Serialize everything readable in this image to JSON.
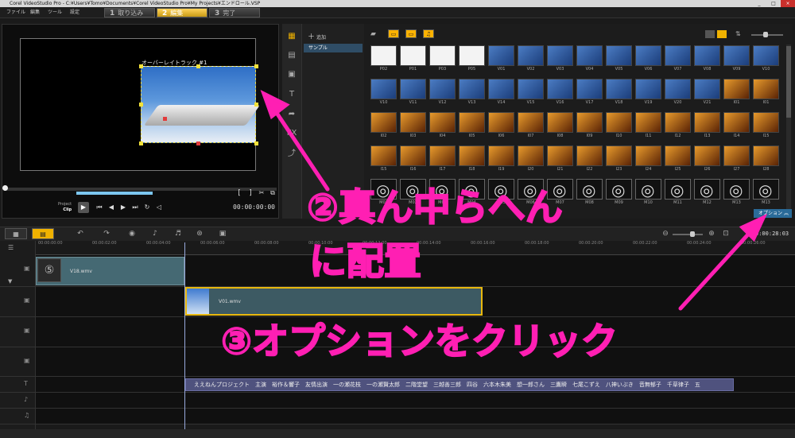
{
  "window": {
    "title": "Corel VideoStudio Pro - C:¥Users¥Tomo¥Documents¥Corel VideoStudio Pro¥My Projects¥エンドロール.VSP"
  },
  "menu": {
    "items": [
      "ファイル",
      "編集",
      "ツール",
      "設定"
    ]
  },
  "steps": [
    {
      "num": "1",
      "label": "取り込み"
    },
    {
      "num": "2",
      "label": "編集"
    },
    {
      "num": "3",
      "label": "完了"
    }
  ],
  "preview": {
    "overlay_title": "オーバーレイトラック #1",
    "project_label": "Project",
    "clip_label": "Clip",
    "timecode": "00:00:00:00"
  },
  "library": {
    "add_label": "追加",
    "folder": "サンプル",
    "option_label": "オプション",
    "thumbs": [
      {
        "label": "P02",
        "kind": "tr"
      },
      {
        "label": "P01",
        "kind": "tr"
      },
      {
        "label": "P03",
        "kind": "tr"
      },
      {
        "label": "P05",
        "kind": "tr"
      },
      {
        "label": "V01",
        "kind": "v"
      },
      {
        "label": "V02",
        "kind": "v"
      },
      {
        "label": "V03",
        "kind": "v"
      },
      {
        "label": "V04",
        "kind": "v"
      },
      {
        "label": "V05",
        "kind": "v"
      },
      {
        "label": "V06",
        "kind": "v"
      },
      {
        "label": "V07",
        "kind": "v"
      },
      {
        "label": "V08",
        "kind": "v"
      },
      {
        "label": "V09",
        "kind": "v"
      },
      {
        "label": "V10",
        "kind": "v"
      },
      {
        "label": "V10",
        "kind": "v"
      },
      {
        "label": "V11",
        "kind": "v"
      },
      {
        "label": "V12",
        "kind": "v"
      },
      {
        "label": "V13",
        "kind": "v"
      },
      {
        "label": "V14",
        "kind": "v"
      },
      {
        "label": "V15",
        "kind": "v"
      },
      {
        "label": "V16",
        "kind": "v"
      },
      {
        "label": "V17",
        "kind": "v"
      },
      {
        "label": "V18",
        "kind": "v"
      },
      {
        "label": "V19",
        "kind": "v"
      },
      {
        "label": "V20",
        "kind": "v"
      },
      {
        "label": "V21",
        "kind": "v"
      },
      {
        "label": "I01",
        "kind": "i"
      },
      {
        "label": "I01",
        "kind": "i"
      },
      {
        "label": "I02",
        "kind": "i"
      },
      {
        "label": "I03",
        "kind": "i"
      },
      {
        "label": "I04",
        "kind": "i"
      },
      {
        "label": "I05",
        "kind": "i"
      },
      {
        "label": "I06",
        "kind": "i"
      },
      {
        "label": "I07",
        "kind": "i"
      },
      {
        "label": "I08",
        "kind": "i"
      },
      {
        "label": "I09",
        "kind": "i"
      },
      {
        "label": "I10",
        "kind": "i"
      },
      {
        "label": "I11",
        "kind": "i"
      },
      {
        "label": "I12",
        "kind": "i"
      },
      {
        "label": "I13",
        "kind": "i"
      },
      {
        "label": "I14",
        "kind": "i"
      },
      {
        "label": "I15",
        "kind": "i"
      },
      {
        "label": "I15",
        "kind": "i"
      },
      {
        "label": "I16",
        "kind": "i"
      },
      {
        "label": "I17",
        "kind": "i"
      },
      {
        "label": "I18",
        "kind": "i"
      },
      {
        "label": "I19",
        "kind": "i"
      },
      {
        "label": "I20",
        "kind": "i"
      },
      {
        "label": "I21",
        "kind": "i"
      },
      {
        "label": "I22",
        "kind": "i"
      },
      {
        "label": "I23",
        "kind": "i"
      },
      {
        "label": "I24",
        "kind": "i"
      },
      {
        "label": "I25",
        "kind": "i"
      },
      {
        "label": "I26",
        "kind": "i"
      },
      {
        "label": "I27",
        "kind": "i"
      },
      {
        "label": "I28",
        "kind": "i"
      },
      {
        "label": "M01",
        "kind": "m"
      },
      {
        "label": "M02",
        "kind": "m"
      },
      {
        "label": "M03",
        "kind": "m"
      },
      {
        "label": "M04",
        "kind": "m"
      },
      {
        "label": "M05",
        "kind": "m"
      },
      {
        "label": "M06",
        "kind": "m"
      },
      {
        "label": "M07",
        "kind": "m"
      },
      {
        "label": "M08",
        "kind": "m"
      },
      {
        "label": "M09",
        "kind": "m"
      },
      {
        "label": "M10",
        "kind": "m"
      },
      {
        "label": "M11",
        "kind": "m"
      },
      {
        "label": "M12",
        "kind": "m"
      },
      {
        "label": "M13",
        "kind": "m"
      },
      {
        "label": "M13",
        "kind": "m"
      }
    ]
  },
  "timeline": {
    "timecode": "0:00:28:03",
    "ruler": [
      "00:00:00:00",
      "00:00:02:00",
      "00:00:04:00",
      "00:00:06:00",
      "00:00:08:00",
      "00:00:10:00",
      "00:00:12:00",
      "00:00:14:00",
      "00:00:16:00",
      "00:00:18:00",
      "00:00:20:00",
      "00:00:22:00",
      "00:00:24:00",
      "00:00:26:00"
    ],
    "clip_video": "V18.wmv",
    "clip_overlay": "V01.wmv",
    "title_clip": "ええねんプロジェクト　主演　裕作＆響子　友情出演　一の瀬花枝　一の瀬賢太郎　二階堂望　三越善三郎　四谷　六本木朱美　想一郎さん　三鷹瞬　七尾こずえ　八神いぶき　音無郁子　千草律子　五"
  },
  "annotations": {
    "step2_line1": "②真ん中らへん",
    "step2_line2": "に配置",
    "step3": "③オプションをクリック"
  },
  "colors": {
    "accent": "#f0b200",
    "annotation": "#ff1fb3"
  }
}
